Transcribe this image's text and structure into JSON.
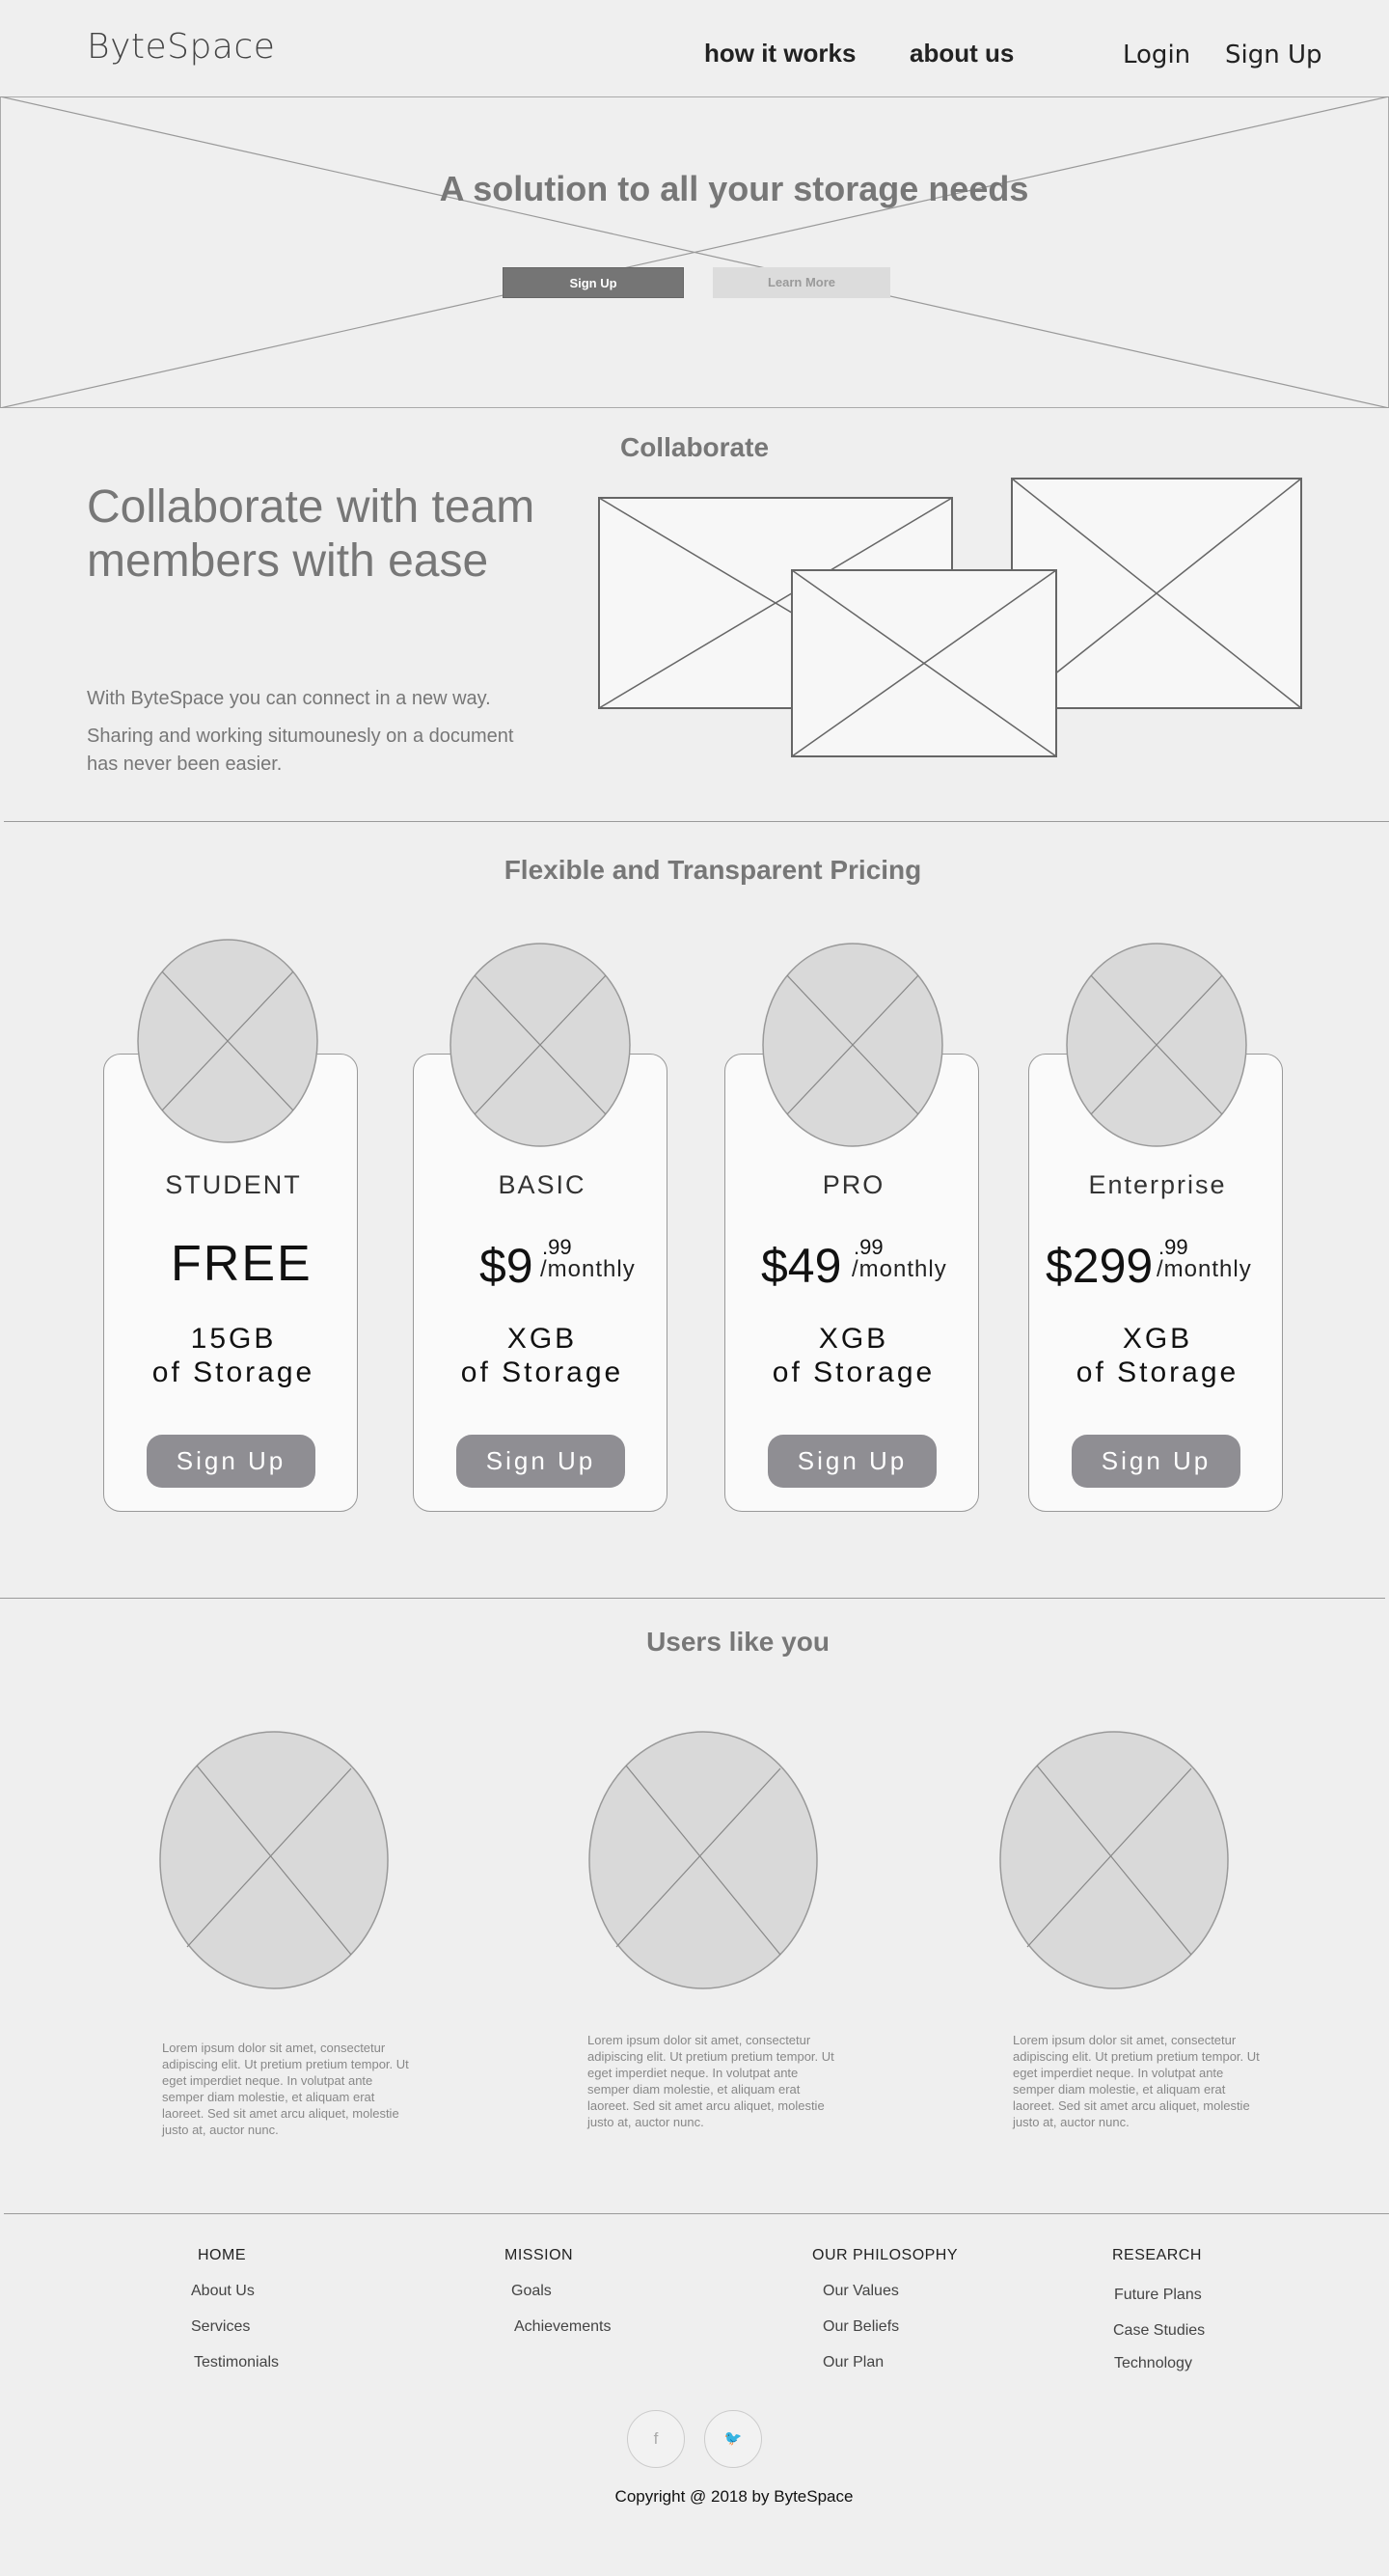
{
  "header": {
    "logo": "ByteSpace",
    "nav": [
      "how it works",
      "about us"
    ],
    "login": "Login",
    "signup": "Sign Up"
  },
  "hero": {
    "title": "A solution to all your storage needs",
    "primary_button": "Sign Up",
    "secondary_button": "Learn More"
  },
  "collaborate": {
    "section_title": "Collaborate",
    "heading": "Collaborate with team members with ease",
    "paragraph_1": "With ByteSpace you can connect in a new way.",
    "paragraph_2": "Sharing and working situmounesly on a document has never been easier."
  },
  "pricing": {
    "title": "Flexible and Transparent Pricing",
    "plans": [
      {
        "name": "STUDENT",
        "price": "FREE",
        "storage_line1": "15GB",
        "storage_line2": "of Storage",
        "button": "Sign Up"
      },
      {
        "name": "BASIC",
        "price": "$9",
        "cents": ".99",
        "period": "/monthly",
        "storage_line1": "XGB",
        "storage_line2": "of Storage",
        "button": "Sign Up"
      },
      {
        "name": "PRO",
        "price": "$49",
        "cents": ".99",
        "period": "/monthly",
        "storage_line1": "XGB",
        "storage_line2": "of Storage",
        "button": "Sign Up"
      },
      {
        "name": "Enterprise",
        "price": "$299",
        "cents": ".99",
        "period": "/monthly",
        "storage_line1": "XGB",
        "storage_line2": "of Storage",
        "button": "Sign Up"
      }
    ]
  },
  "testimonials": {
    "title": "Users like you",
    "items": [
      {
        "text": "Lorem ipsum dolor sit amet, consectetur adipiscing elit. Ut pretium pretium tempor. Ut eget imperdiet neque. In volutpat ante semper diam molestie, et aliquam erat laoreet. Sed sit amet arcu aliquet, molestie justo at, auctor nunc."
      },
      {
        "text": "Lorem ipsum dolor sit amet, consectetur adipiscing elit. Ut pretium pretium tempor. Ut eget imperdiet neque. In volutpat ante semper diam molestie, et aliquam erat laoreet. Sed sit amet arcu aliquet, molestie justo at, auctor nunc."
      },
      {
        "text": "Lorem ipsum dolor sit amet, consectetur adipiscing elit. Ut pretium pretium tempor. Ut eget imperdiet neque. In volutpat ante semper diam molestie, et aliquam erat laoreet. Sed sit amet arcu aliquet, molestie justo at, auctor nunc."
      }
    ]
  },
  "footer": {
    "columns": [
      {
        "heading": "HOME",
        "links": [
          "About Us",
          "Services",
          "Testimonials"
        ]
      },
      {
        "heading": "MISSION",
        "links": [
          "Goals",
          "Achievements"
        ]
      },
      {
        "heading": "OUR PHILOSOPHY",
        "links": [
          "Our Values",
          "Our Beliefs",
          "Our Plan"
        ]
      },
      {
        "heading": "RESEARCH",
        "links": [
          "Future Plans",
          "Case Studies",
          "Technology"
        ]
      }
    ],
    "social": [
      {
        "icon": "facebook-icon",
        "glyph": "f"
      },
      {
        "icon": "twitter-icon",
        "glyph": "🐦"
      }
    ],
    "copyright": "Copyright @ 2018 by ByteSpace"
  }
}
